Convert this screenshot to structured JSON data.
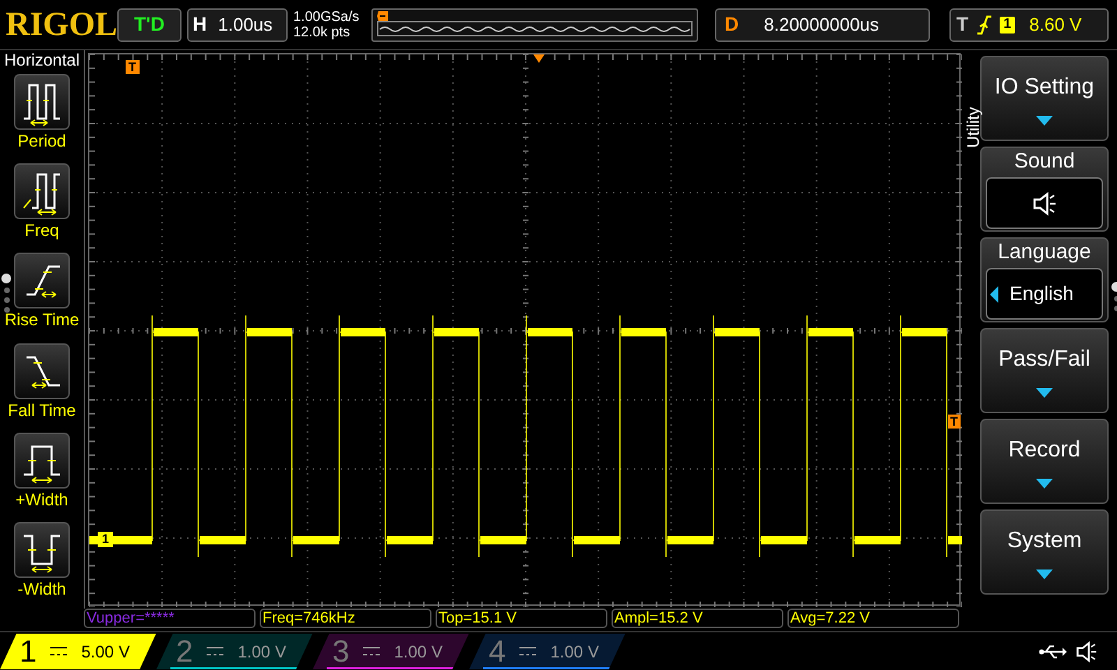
{
  "brand": "RIGOL",
  "run_status": "T'D",
  "horizontal": {
    "label": "H",
    "timebase": "1.00us"
  },
  "acquisition": {
    "sample_rate": "1.00GSa/s",
    "memory_depth": "12.0k pts"
  },
  "delay": {
    "label": "D",
    "value": "8.20000000us"
  },
  "trigger": {
    "label": "T",
    "source": "1",
    "level": "8.60 V"
  },
  "left_menu": {
    "title": "Horizontal",
    "items": [
      {
        "label": "Period",
        "kind": "period"
      },
      {
        "label": "Freq",
        "kind": "freq"
      },
      {
        "label": "Rise Time",
        "kind": "rise"
      },
      {
        "label": "Fall Time",
        "kind": "fall"
      },
      {
        "label": "+Width",
        "kind": "pwidth"
      },
      {
        "label": "-Width",
        "kind": "nwidth"
      }
    ],
    "pages": [
      {
        "selected": true
      },
      {
        "selected": false
      },
      {
        "selected": false
      },
      {
        "selected": false
      }
    ]
  },
  "markers": {
    "trigger_position": "T",
    "channel": "1",
    "trigger_level": "T"
  },
  "right_menu": {
    "title": "Utility",
    "items": [
      {
        "label": "IO Setting",
        "kind": "submenu"
      },
      {
        "label": "Sound",
        "kind": "sound",
        "on": true
      },
      {
        "label": "Language",
        "kind": "select",
        "value": "English"
      },
      {
        "label": "Pass/Fail",
        "kind": "submenu"
      },
      {
        "label": "Record",
        "kind": "submenu"
      },
      {
        "label": "System",
        "kind": "submenu"
      }
    ],
    "pages": [
      {
        "selected": true
      },
      {
        "selected": false
      },
      {
        "selected": false
      }
    ]
  },
  "measurements": [
    {
      "text": "Vupper=*****",
      "color": "#8a2be2"
    },
    {
      "text": "Freq=746kHz",
      "color": "#ffff00"
    },
    {
      "text": "Top=15.1 V",
      "color": "#ffff00"
    },
    {
      "text": "Ampl=15.2 V",
      "color": "#ffff00"
    },
    {
      "text": "Avg=7.22 V",
      "color": "#ffff00"
    }
  ],
  "channels": [
    {
      "number": "1",
      "scale": "5.00 V",
      "on": true,
      "color": "#ffff00"
    },
    {
      "number": "2",
      "scale": "1.00 V",
      "on": false,
      "color": "#00c8c8"
    },
    {
      "number": "3",
      "scale": "1.00 V",
      "on": false,
      "color": "#e020e0"
    },
    {
      "number": "4",
      "scale": "1.00 V",
      "on": false,
      "color": "#2080ff"
    }
  ]
}
